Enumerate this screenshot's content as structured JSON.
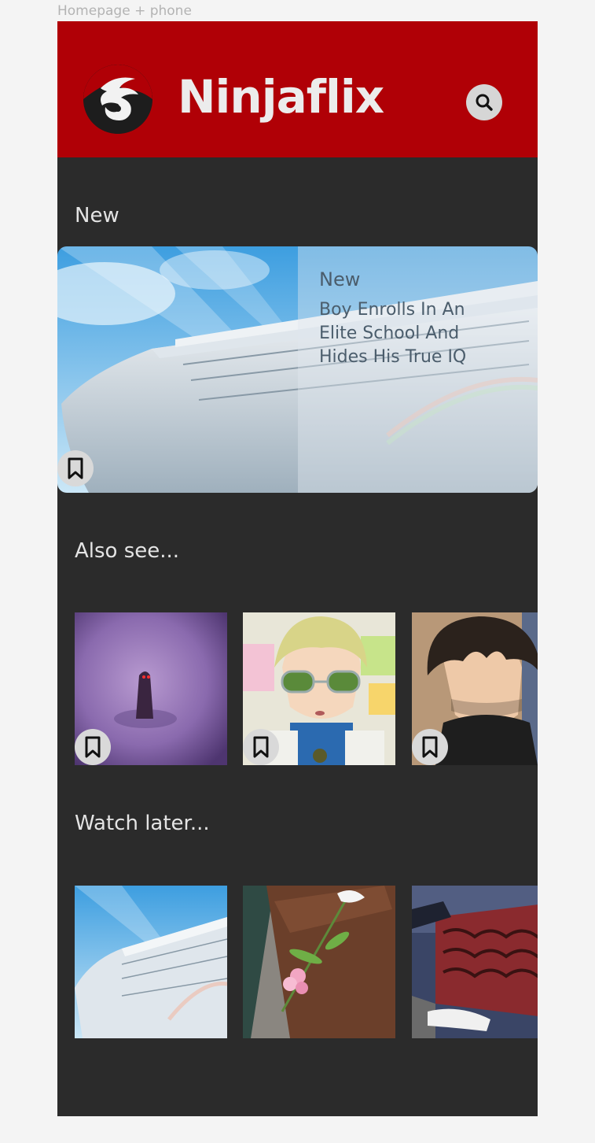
{
  "frame_label": "Homepage + phone",
  "header": {
    "brand": "Ninjaflix",
    "logo_icon": "ninja-dragon-logo-icon",
    "search_icon": "search-icon",
    "color": "#b00006"
  },
  "sections": {
    "new_title": "New",
    "also_see_title": "Also see...",
    "watch_later_title": "Watch later..."
  },
  "hero": {
    "kicker": "New",
    "title": "Boy Enrolls In An Elite School And Hides His True IQ",
    "bookmark_icon": "bookmark-icon"
  },
  "also_see": [
    {
      "art": "purple-figure-art",
      "bookmark_icon": "bookmark-icon"
    },
    {
      "art": "blonde-glasses-character-art",
      "bookmark_icon": "bookmark-icon"
    },
    {
      "art": "dark-hair-character-art",
      "bookmark_icon": "bookmark-icon"
    }
  ],
  "watch_later": [
    {
      "art": "cruise-ship-art"
    },
    {
      "art": "flower-on-coffin-art"
    },
    {
      "art": "piano-hands-art"
    }
  ]
}
